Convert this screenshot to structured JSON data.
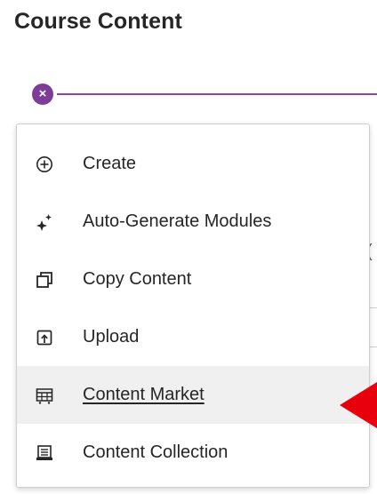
{
  "header": {
    "title": "Course Content"
  },
  "toolbar": {
    "close_icon": "close-icon"
  },
  "background": {
    "partial_text": "("
  },
  "menu": {
    "items": [
      {
        "label": "Create",
        "icon": "plus-circle-icon"
      },
      {
        "label": "Auto-Generate Modules",
        "icon": "sparkle-icon"
      },
      {
        "label": "Copy Content",
        "icon": "copy-icon"
      },
      {
        "label": "Upload",
        "icon": "upload-icon"
      },
      {
        "label": "Content Market",
        "icon": "market-icon",
        "hovered": true
      },
      {
        "label": "Content Collection",
        "icon": "collection-icon"
      }
    ]
  },
  "colors": {
    "accent": "#8e44ad",
    "close_button": "#7d3c98",
    "annotation_arrow": "#e8000c",
    "hover_background": "#f0f0f0"
  }
}
